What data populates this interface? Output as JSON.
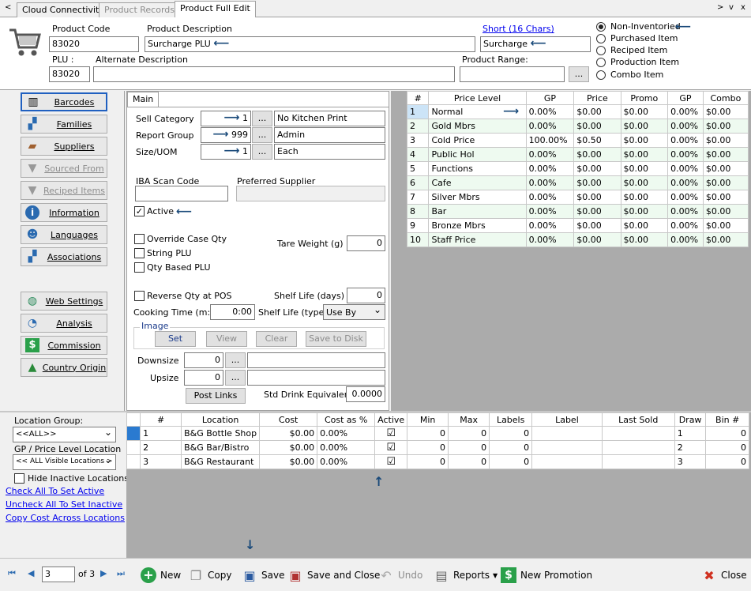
{
  "tabs": [
    {
      "label": "Cloud Connectivity",
      "state": "normal"
    },
    {
      "label": "Product Records",
      "state": "disabled"
    },
    {
      "label": "Product Full Edit",
      "state": "active"
    }
  ],
  "nav": {
    "left": "<",
    "right": ">",
    "down": "v",
    "close": "x"
  },
  "header": {
    "product_code_label": "Product Code",
    "product_code": "83020",
    "product_desc_label": "Product Description",
    "product_desc": "Surcharge PLU",
    "short_link": "Short (16 Chars)",
    "short_value": "Surcharge",
    "plu_label": "PLU :",
    "plu": "83020",
    "alt_desc_label": "Alternate Description",
    "alt_desc": "",
    "range_label": "Product Range:",
    "range_value": "",
    "range_btn": "...",
    "item_types": [
      {
        "label": "Non-Inventoried",
        "selected": true
      },
      {
        "label": "Purchased Item",
        "selected": false
      },
      {
        "label": "Reciped Item",
        "selected": false
      },
      {
        "label": "Production Item",
        "selected": false
      },
      {
        "label": "Combo Item",
        "selected": false
      }
    ]
  },
  "sidebar": {
    "top": [
      {
        "label": "Barcodes",
        "icon": "barcode-icon",
        "state": "selected"
      },
      {
        "label": "Families",
        "icon": "families-icon",
        "state": "normal"
      },
      {
        "label": "Suppliers",
        "icon": "truck-icon",
        "state": "normal"
      },
      {
        "label": "Sourced From",
        "icon": "funnel-icon",
        "state": "disabled"
      },
      {
        "label": "Reciped Items",
        "icon": "funnel-icon",
        "state": "disabled"
      },
      {
        "label": "Information",
        "icon": "info-icon",
        "state": "normal"
      },
      {
        "label": "Languages",
        "icon": "person-icon",
        "state": "normal"
      },
      {
        "label": "Associations",
        "icon": "network-icon",
        "state": "normal"
      }
    ],
    "bottom": [
      {
        "label": "Web Settings",
        "icon": "globe-icon"
      },
      {
        "label": "Analysis",
        "icon": "gauge-icon"
      },
      {
        "label": "Commission",
        "icon": "dollar-icon"
      },
      {
        "label": "Country Origin",
        "icon": "australia-icon"
      }
    ]
  },
  "main": {
    "tab": "Main",
    "sell_category_label": "Sell Category",
    "sell_category_num": "1",
    "sell_category_name": "No Kitchen Print",
    "report_group_label": "Report Group",
    "report_group_num": "999",
    "report_group_name": "Admin",
    "size_uom_label": "Size/UOM",
    "size_uom_num": "1",
    "size_uom_name": "Each",
    "ellipsis": "...",
    "iba_label": "IBA Scan Code",
    "iba_value": "",
    "pref_supplier_label": "Preferred Supplier",
    "pref_supplier_value": "",
    "active_label": "Active",
    "override_label": "Override Case Qty",
    "string_plu_label": "String PLU",
    "qty_based_label": "Qty Based PLU",
    "tare_label": "Tare Weight (g) :",
    "tare_value": "0",
    "reverse_label": "Reverse Qty at POS",
    "shelf_days_label": "Shelf Life (days) :",
    "shelf_days_value": "0",
    "cooking_label": "Cooking Time (m:s)",
    "cooking_value": "0:00",
    "shelf_type_label": "Shelf Life (type) :",
    "shelf_type_value": "Use By",
    "image_label": "Image",
    "btn_set": "Set",
    "btn_view": "View",
    "btn_clear": "Clear",
    "btn_save_disk": "Save to Disk",
    "downsize_label": "Downsize",
    "downsize_value": "0",
    "upsize_label": "Upsize",
    "upsize_value": "0",
    "post_links": "Post Links",
    "std_drink_label": "Std Drink Equivalent:",
    "std_drink_value": "0.0000"
  },
  "price_grid": {
    "headers": [
      "#",
      "Price Level",
      "GP",
      "Price",
      "Promo",
      "GP",
      "Combo"
    ],
    "rows": [
      [
        "1",
        "Normal",
        "0.00%",
        "$0.00",
        "$0.00",
        "0.00%",
        "$0.00"
      ],
      [
        "2",
        "Gold Mbrs",
        "0.00%",
        "$0.00",
        "$0.00",
        "0.00%",
        "$0.00"
      ],
      [
        "3",
        "Cold Price",
        "100.00%",
        "$0.50",
        "$0.00",
        "0.00%",
        "$0.00"
      ],
      [
        "4",
        "Public Hol",
        "0.00%",
        "$0.00",
        "$0.00",
        "0.00%",
        "$0.00"
      ],
      [
        "5",
        "Functions",
        "0.00%",
        "$0.00",
        "$0.00",
        "0.00%",
        "$0.00"
      ],
      [
        "6",
        "Cafe",
        "0.00%",
        "$0.00",
        "$0.00",
        "0.00%",
        "$0.00"
      ],
      [
        "7",
        "Silver Mbrs",
        "0.00%",
        "$0.00",
        "$0.00",
        "0.00%",
        "$0.00"
      ],
      [
        "8",
        "Bar",
        "0.00%",
        "$0.00",
        "$0.00",
        "0.00%",
        "$0.00"
      ],
      [
        "9",
        "Bronze Mbrs",
        "0.00%",
        "$0.00",
        "$0.00",
        "0.00%",
        "$0.00"
      ],
      [
        "10",
        "Staff Price",
        "0.00%",
        "$0.00",
        "$0.00",
        "0.00%",
        "$0.00"
      ]
    ]
  },
  "location_panel": {
    "location_group_label": "Location Group:",
    "location_group_value": "<<ALL>>",
    "gp_label": "GP / Price Level Location",
    "gp_value": "<< ALL Visible Locations >",
    "hide_inactive_label": "Hide Inactive Locations",
    "check_all": "Check All To Set Active",
    "uncheck_all": "Uncheck All To Set Inactive",
    "copy_cost": "Copy Cost Across Locations"
  },
  "location_grid": {
    "headers": [
      "#",
      "Location",
      "Cost",
      "Cost as %",
      "Active",
      "Min",
      "Max",
      "Labels",
      "Label",
      "Last Sold",
      "Draw",
      "Bin #"
    ],
    "rows": [
      [
        "1",
        "B&G Bottle Shop",
        "$0.00",
        "0.00%",
        "☑",
        "0",
        "0",
        "0",
        "",
        "",
        "1",
        "0"
      ],
      [
        "2",
        "B&G Bar/Bistro",
        "$0.00",
        "0.00%",
        "☑",
        "0",
        "0",
        "0",
        "",
        "",
        "2",
        "0"
      ],
      [
        "3",
        "B&G Restaurant",
        "$0.00",
        "0.00%",
        "☑",
        "0",
        "0",
        "0",
        "",
        "",
        "3",
        "0"
      ]
    ]
  },
  "toolbar": {
    "record": "3",
    "of": "of 3",
    "new": "New",
    "copy": "Copy",
    "save": "Save",
    "save_close": "Save and Close",
    "undo": "Undo",
    "reports": "Reports",
    "new_promo": "New Promotion",
    "close": "Close"
  },
  "colors": {
    "arrow": "#1a4a7a",
    "selection": "#cce4f7",
    "alt_row": "#eefaf0",
    "link": "#0000ee"
  }
}
